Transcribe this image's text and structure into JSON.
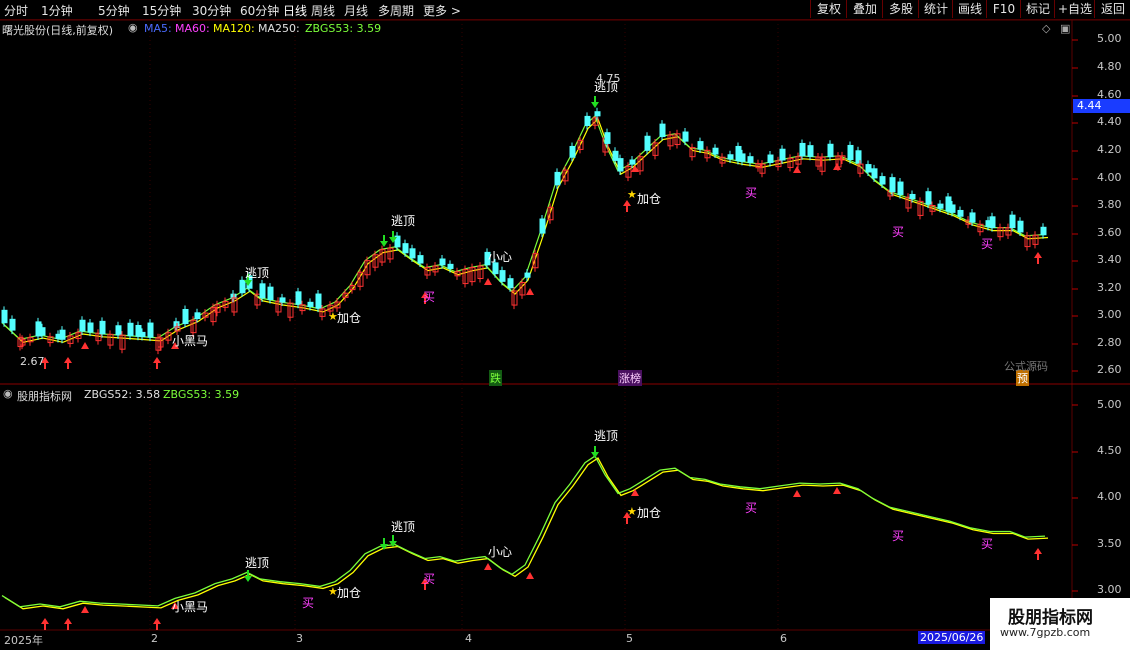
{
  "toolbar": {
    "periods": [
      "分时",
      "1分钟",
      "5分钟",
      "15分钟",
      "30分钟",
      "60分钟",
      "日线",
      "周线",
      "月线",
      "多周期",
      "更多 >"
    ],
    "buttons": [
      "复权",
      "叠加",
      "多股",
      "统计",
      "画线",
      "F10",
      "标记",
      "+自选",
      "返回"
    ]
  },
  "main_header": {
    "title": "曙光股份(日线,前复权)",
    "ma5": "MA5:",
    "ma60": "MA60:",
    "ma120": "MA120:",
    "ma250": "MA250:",
    "zbgs53": "ZBGS53: 3.59"
  },
  "sub_header": {
    "title": "股朋指标网",
    "zbgs52": "ZBGS52: 3.58",
    "zbgs53": "ZBGS53: 3.59"
  },
  "price_axis": [
    "5.00",
    "4.80",
    "4.60",
    "4.40",
    "4.20",
    "4.00",
    "3.80",
    "3.60",
    "3.40",
    "3.20",
    "3.00",
    "2.80",
    "2.60"
  ],
  "current_price": "4.44",
  "sub_axis": [
    "5.00",
    "4.50",
    "4.00",
    "3.50",
    "3.00"
  ],
  "x_axis": [
    "2025年",
    "2",
    "3",
    "4",
    "5",
    "6"
  ],
  "date_marker": "2025/06/26",
  "high_label": "4.75",
  "low_label": "2.67",
  "main_annotations": {
    "taoding": "逃顶",
    "jiacang": "加仓",
    "xiaoheima": "小黑马",
    "xiaoxin": "小心",
    "mai": "买"
  },
  "bottom_tags": [
    "跌",
    "涨榜",
    "预"
  ],
  "overlay_text": "公式源码",
  "watermark": {
    "line1": "股朋指标网",
    "line2": "www.7gpzb.com"
  },
  "colors": {
    "up": "#ff3232",
    "down": "#54ffff",
    "ma_yellow": "#ffff00",
    "ma_green": "#7cff3a",
    "magenta": "#ff40ff",
    "grid": "#5a0000"
  }
}
